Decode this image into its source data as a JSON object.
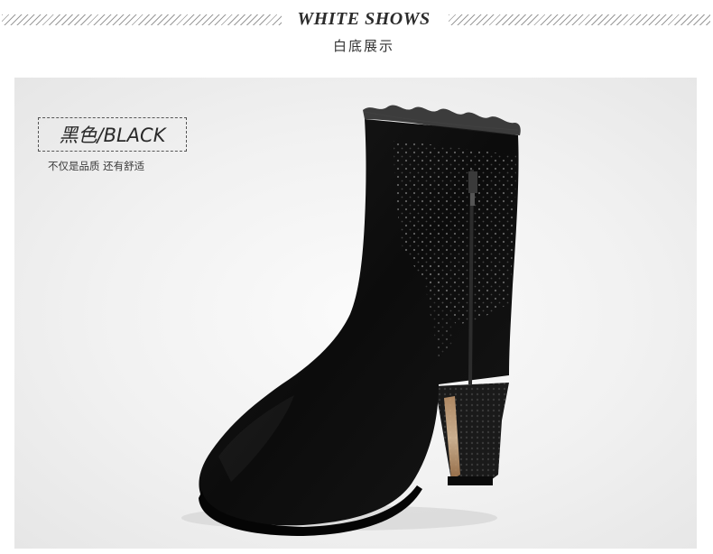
{
  "header": {
    "title": "WHITE SHOWS",
    "subtitle": "白底展示"
  },
  "product": {
    "color_label": "黑色/BLACK",
    "caption": "不仅是品质 还有舒适",
    "image_subject": "black-ankle-boot"
  },
  "colors": {
    "background": "#ffffff",
    "stage": "#f1f1f1",
    "boot": "#0e0e0e",
    "text": "#2a2a2a"
  }
}
